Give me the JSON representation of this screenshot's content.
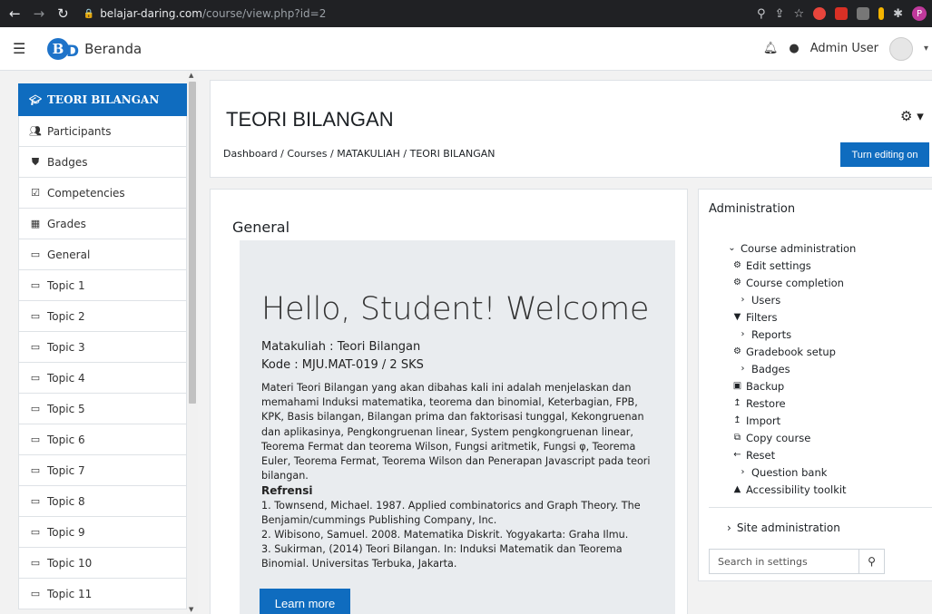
{
  "browser": {
    "url_host": "belajar-daring.com",
    "url_path": "/course/view.php?id=2",
    "profile_initial": "P"
  },
  "navbar": {
    "brand": "Beranda",
    "user_name": "Admin User"
  },
  "drawer": {
    "items": [
      {
        "label": "TEORI BILANGAN",
        "icon": "graduation-cap-icon"
      },
      {
        "label": "Participants",
        "icon": "users-icon"
      },
      {
        "label": "Badges",
        "icon": "shield-icon"
      },
      {
        "label": "Competencies",
        "icon": "check-square-icon"
      },
      {
        "label": "Grades",
        "icon": "table-icon"
      },
      {
        "label": "General",
        "icon": "folder-icon"
      },
      {
        "label": "Topic 1",
        "icon": "folder-icon"
      },
      {
        "label": "Topic 2",
        "icon": "folder-icon"
      },
      {
        "label": "Topic 3",
        "icon": "folder-icon"
      },
      {
        "label": "Topic 4",
        "icon": "folder-icon"
      },
      {
        "label": "Topic 5",
        "icon": "folder-icon"
      },
      {
        "label": "Topic 6",
        "icon": "folder-icon"
      },
      {
        "label": "Topic 7",
        "icon": "folder-icon"
      },
      {
        "label": "Topic 8",
        "icon": "folder-icon"
      },
      {
        "label": "Topic 9",
        "icon": "folder-icon"
      },
      {
        "label": "Topic 10",
        "icon": "folder-icon"
      },
      {
        "label": "Topic 11",
        "icon": "folder-icon"
      }
    ]
  },
  "header": {
    "title": "TEORI BILANGAN",
    "breadcrumb": "Dashboard / Courses / MATAKULIAH / TEORI BILANGAN",
    "edit_button": "Turn editing on"
  },
  "main": {
    "section_title": "General",
    "hello": "Hello, Student! Welcome",
    "matakuliah": "Matakuliah : Teori Bilangan",
    "kode": "Kode : MJU.MAT-019 / 2 SKS",
    "description": "Materi Teori Bilangan yang akan dibahas kali ini adalah menjelaskan dan memahami Induksi matematika, teorema dan binomial, Keterbagian, FPB, KPK, Basis bilangan, Bilangan prima dan faktorisasi tunggal, Kekongruenan dan aplikasinya, Pengkongruenan linear, System pengkongruenan linear, Teorema Fermat dan teorema Wilson, Fungsi aritmetik, Fungsi φ, Teorema Euler, Teorema Fermat, Teorema Wilson dan Penerapan Javascript pada teori bilangan.",
    "ref_title": "Refrensi",
    "ref1": "1. Townsend, Michael. 1987. Applied combinatorics and Graph Theory. The Benjamin/cummings Publishing Company, Inc.",
    "ref2": "2. Wibisono, Samuel. 2008. Matematika Diskrit. Yogyakarta: Graha Ilmu.",
    "ref3": "3. Sukirman, (2014) Teori Bilangan. In: Induksi Matematik dan Teorema Binomial. Universitas Terbuka, Jakarta.",
    "learn_more": "Learn more"
  },
  "admin": {
    "title": "Administration",
    "course_admin": "Course administration",
    "items": [
      {
        "label": "Edit settings",
        "icon": "gear-icon",
        "level": 1
      },
      {
        "label": "Course completion",
        "icon": "gear-icon",
        "level": 1
      },
      {
        "label": "Users",
        "icon": "chevron-right-icon",
        "level": 2
      },
      {
        "label": "Filters",
        "icon": "filter-icon",
        "level": 1
      },
      {
        "label": "Reports",
        "icon": "chevron-right-icon",
        "level": 2
      },
      {
        "label": "Gradebook setup",
        "icon": "gear-icon",
        "level": 1
      },
      {
        "label": "Badges",
        "icon": "chevron-right-icon",
        "level": 2
      },
      {
        "label": "Backup",
        "icon": "file-icon",
        "level": 1
      },
      {
        "label": "Restore",
        "icon": "upload-icon",
        "level": 1
      },
      {
        "label": "Import",
        "icon": "upload-icon",
        "level": 1
      },
      {
        "label": "Copy course",
        "icon": "copy-icon",
        "level": 1
      },
      {
        "label": "Reset",
        "icon": "arrow-left-icon",
        "level": 1
      },
      {
        "label": "Question bank",
        "icon": "chevron-right-icon",
        "level": 2
      },
      {
        "label": "Accessibility toolkit",
        "icon": "chart-icon",
        "level": 1
      }
    ],
    "site_admin": "Site administration",
    "search_placeholder": "Search in settings"
  }
}
